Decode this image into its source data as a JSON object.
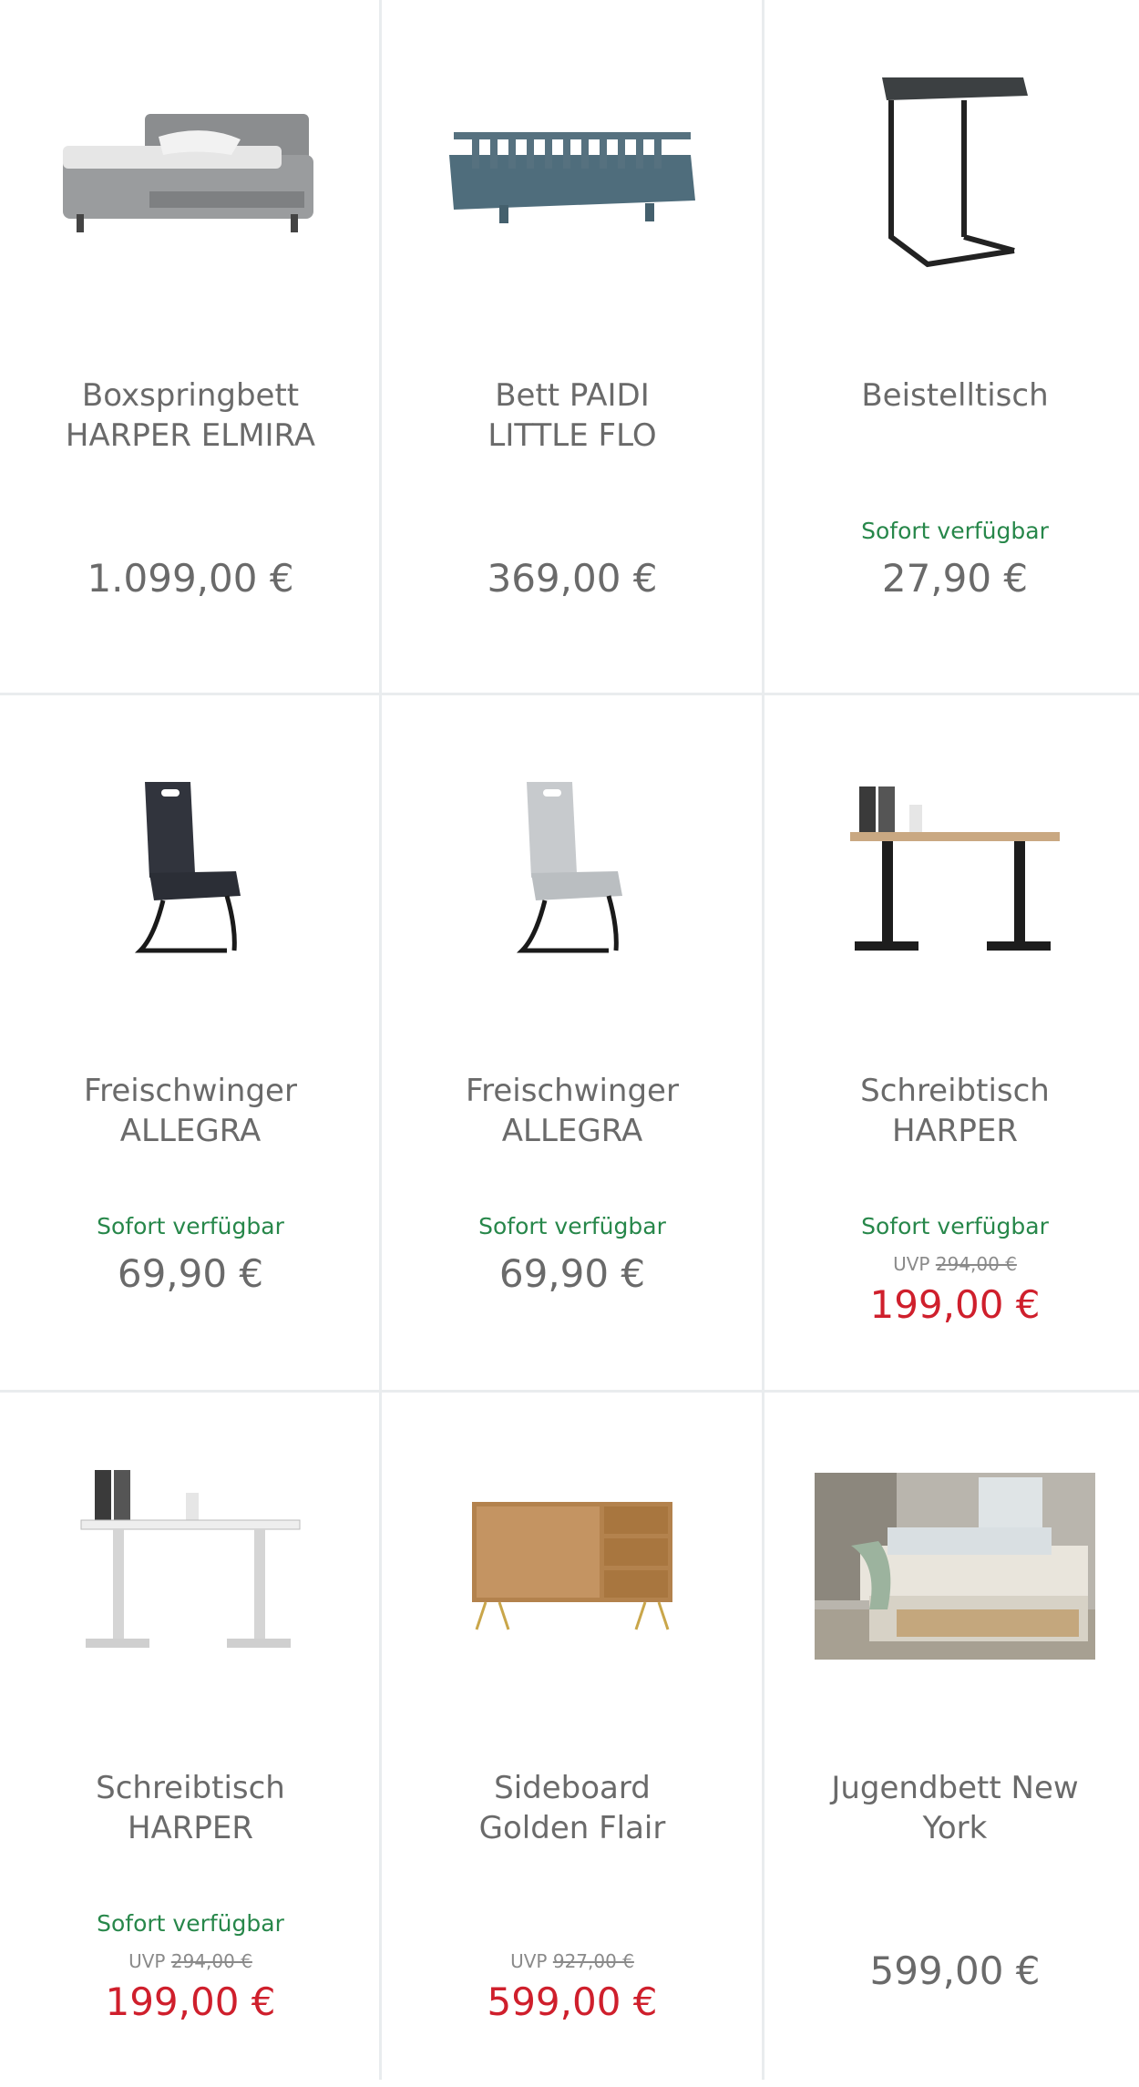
{
  "products": [
    {
      "title1": "Boxspringbett",
      "title2": "HARPER ELMIRA",
      "availability": "",
      "uvp_label": "",
      "uvp_price": "",
      "price": "1.099,00 €",
      "sale": false
    },
    {
      "title1": "Bett PAIDI",
      "title2": "LITTLE FLO",
      "availability": "",
      "uvp_label": "",
      "uvp_price": "",
      "price": "369,00 €",
      "sale": false
    },
    {
      "title1": "Beistelltisch",
      "title2": "",
      "availability": "Sofort verfügbar",
      "uvp_label": "",
      "uvp_price": "",
      "price": "27,90 €",
      "sale": false
    },
    {
      "title1": "Freischwinger",
      "title2": "ALLEGRA",
      "availability": "Sofort verfügbar",
      "uvp_label": "",
      "uvp_price": "",
      "price": "69,90 €",
      "sale": false
    },
    {
      "title1": "Freischwinger",
      "title2": "ALLEGRA",
      "availability": "Sofort verfügbar",
      "uvp_label": "",
      "uvp_price": "",
      "price": "69,90 €",
      "sale": false
    },
    {
      "title1": "Schreibtisch",
      "title2": "HARPER",
      "availability": "Sofort verfügbar",
      "uvp_label": "UVP",
      "uvp_price": "294,00 €",
      "price": "199,00 €",
      "sale": true
    },
    {
      "title1": "Schreibtisch",
      "title2": "HARPER",
      "availability": "Sofort verfügbar",
      "uvp_label": "UVP",
      "uvp_price": "294,00 €",
      "price": "199,00 €",
      "sale": true
    },
    {
      "title1": "Sideboard",
      "title2": "Golden Flair",
      "availability": "",
      "uvp_label": "UVP",
      "uvp_price": "927,00 €",
      "price": "599,00 €",
      "sale": true
    },
    {
      "title1": "Jugendbett New",
      "title2": "York",
      "availability": "",
      "uvp_label": "",
      "uvp_price": "",
      "price": "599,00 €",
      "sale": false
    }
  ],
  "colors": {
    "availability": "#27874a",
    "sale_price": "#cf1f2c",
    "text": "#6a6a6a",
    "divider": "#e9ecee"
  }
}
